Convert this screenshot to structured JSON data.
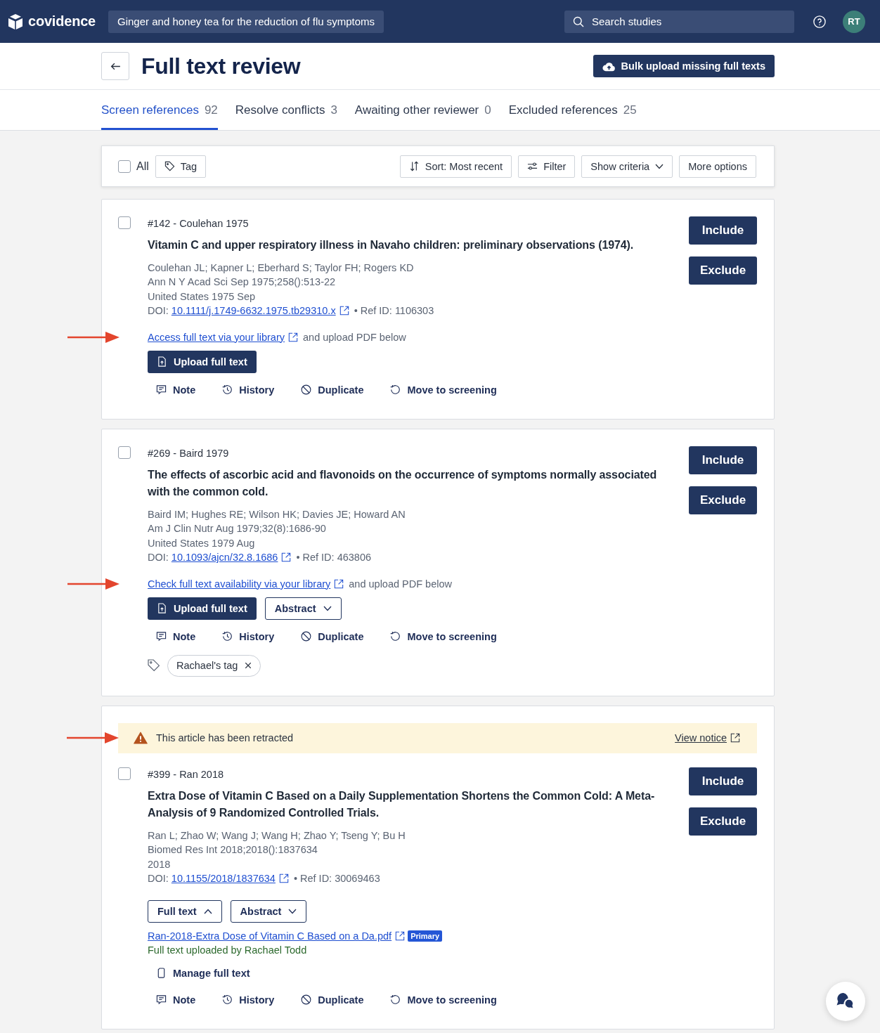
{
  "top_bar": {
    "logo": "covidence",
    "project_title": "Ginger and honey tea for the reduction of flu symptoms",
    "search": {
      "placeholder": "Search studies"
    },
    "avatar": "RT"
  },
  "header": {
    "title": "Full text review",
    "bulk_upload_button": "Bulk upload missing full texts"
  },
  "tabs": [
    {
      "label": "Screen references",
      "count": "92",
      "selected": true
    },
    {
      "label": "Resolve conflicts",
      "count": "3",
      "selected": false
    },
    {
      "label": "Awaiting other reviewer",
      "count": "0",
      "selected": false
    },
    {
      "label": "Excluded references",
      "count": "25",
      "selected": false
    }
  ],
  "toolbar": {
    "select_all": {
      "label": "All",
      "checked": false
    },
    "tag_button": "Tag",
    "actions": [
      {
        "kind": "sort",
        "label": "Sort: Most recent"
      },
      {
        "kind": "filter",
        "label": "Filter"
      },
      {
        "kind": "criteria",
        "label": "Show criteria",
        "expanded": false
      },
      {
        "kind": "more",
        "label": "More options"
      }
    ]
  },
  "references": [
    {
      "checked": false,
      "heading": "#142 - Coulehan 1975",
      "title": "Vitamin C and upper respiratory illness in Navaho children: preliminary observations (1974).",
      "authors": "Coulehan JL; Kapner L; Eberhard S; Taylor FH; Rogers KD",
      "journal": "Ann N Y Acad Sci Sep 1975;258():513-22",
      "published": "United States 1975 Sep",
      "doi": {
        "label": "DOI:",
        "link": "10.1111/j.1749-6632.1975.tb29310.x",
        "ref_id": "• Ref ID: 1106303"
      },
      "library": {
        "link": "Access full text via your library",
        "hint": "and upload PDF below",
        "arrow": true
      },
      "buttons": [
        {
          "kind": "upload",
          "label": "Upload full text"
        }
      ],
      "actions": [
        {
          "kind": "note",
          "label": "Note"
        },
        {
          "kind": "history",
          "label": "History"
        },
        {
          "kind": "duplicate",
          "label": "Duplicate"
        },
        {
          "kind": "move",
          "label": "Move to screening"
        }
      ],
      "decisions": [
        "Include",
        "Exclude"
      ]
    },
    {
      "checked": false,
      "heading": "#269 - Baird 1979",
      "title": "The effects of ascorbic acid and flavonoids on the occurrence of symptoms normally associated with the common cold.",
      "authors": "Baird IM; Hughes RE; Wilson HK; Davies JE; Howard AN",
      "journal": "Am J Clin Nutr Aug 1979;32(8):1686-90",
      "published": "United States 1979 Aug",
      "doi": {
        "label": "DOI:",
        "link": "10.1093/ajcn/32.8.1686",
        "ref_id": "• Ref ID: 463806"
      },
      "library": {
        "link": "Check full text availability via your library",
        "hint": "and upload PDF below",
        "arrow": true
      },
      "buttons": [
        {
          "kind": "upload",
          "label": "Upload full text"
        },
        {
          "kind": "dropdown",
          "label": "Abstract",
          "expanded": false
        }
      ],
      "actions": [
        {
          "kind": "note",
          "label": "Note"
        },
        {
          "kind": "history",
          "label": "History"
        },
        {
          "kind": "duplicate",
          "label": "Duplicate"
        },
        {
          "kind": "move",
          "label": "Move to screening"
        }
      ],
      "tags": [
        {
          "label": "Rachael's tag"
        }
      ],
      "decisions": [
        "Include",
        "Exclude"
      ]
    },
    {
      "retraction": {
        "text": "This article has been retracted",
        "link": "View notice",
        "arrow": true
      },
      "checked": false,
      "heading": "#399 - Ran 2018",
      "title": "Extra Dose of Vitamin C Based on a Daily Supplementation Shortens the Common Cold: A Meta-Analysis of 9 Randomized Controlled Trials.",
      "authors": "Ran L; Zhao W; Wang J; Wang H; Zhao Y; Tseng Y; Bu H",
      "journal": "Biomed Res Int 2018;2018():1837634",
      "published": "2018",
      "doi": {
        "label": "DOI:",
        "link": "10.1155/2018/1837634",
        "ref_id": "• Ref ID: 30069463"
      },
      "buttons": [
        {
          "kind": "dropdown",
          "label": "Full text",
          "expanded": true
        },
        {
          "kind": "dropdown",
          "label": "Abstract",
          "expanded": false
        }
      ],
      "full_text": {
        "file": "Ran-2018-Extra Dose of Vitamin C Based on a Da.pdf",
        "badge": "Primary",
        "status": "Full text uploaded by Rachael Todd",
        "manage": "Manage full text"
      },
      "actions": [
        {
          "kind": "note",
          "label": "Note"
        },
        {
          "kind": "history",
          "label": "History"
        },
        {
          "kind": "duplicate",
          "label": "Duplicate"
        },
        {
          "kind": "move",
          "label": "Move to screening"
        }
      ],
      "decisions": [
        "Include",
        "Exclude"
      ]
    }
  ]
}
